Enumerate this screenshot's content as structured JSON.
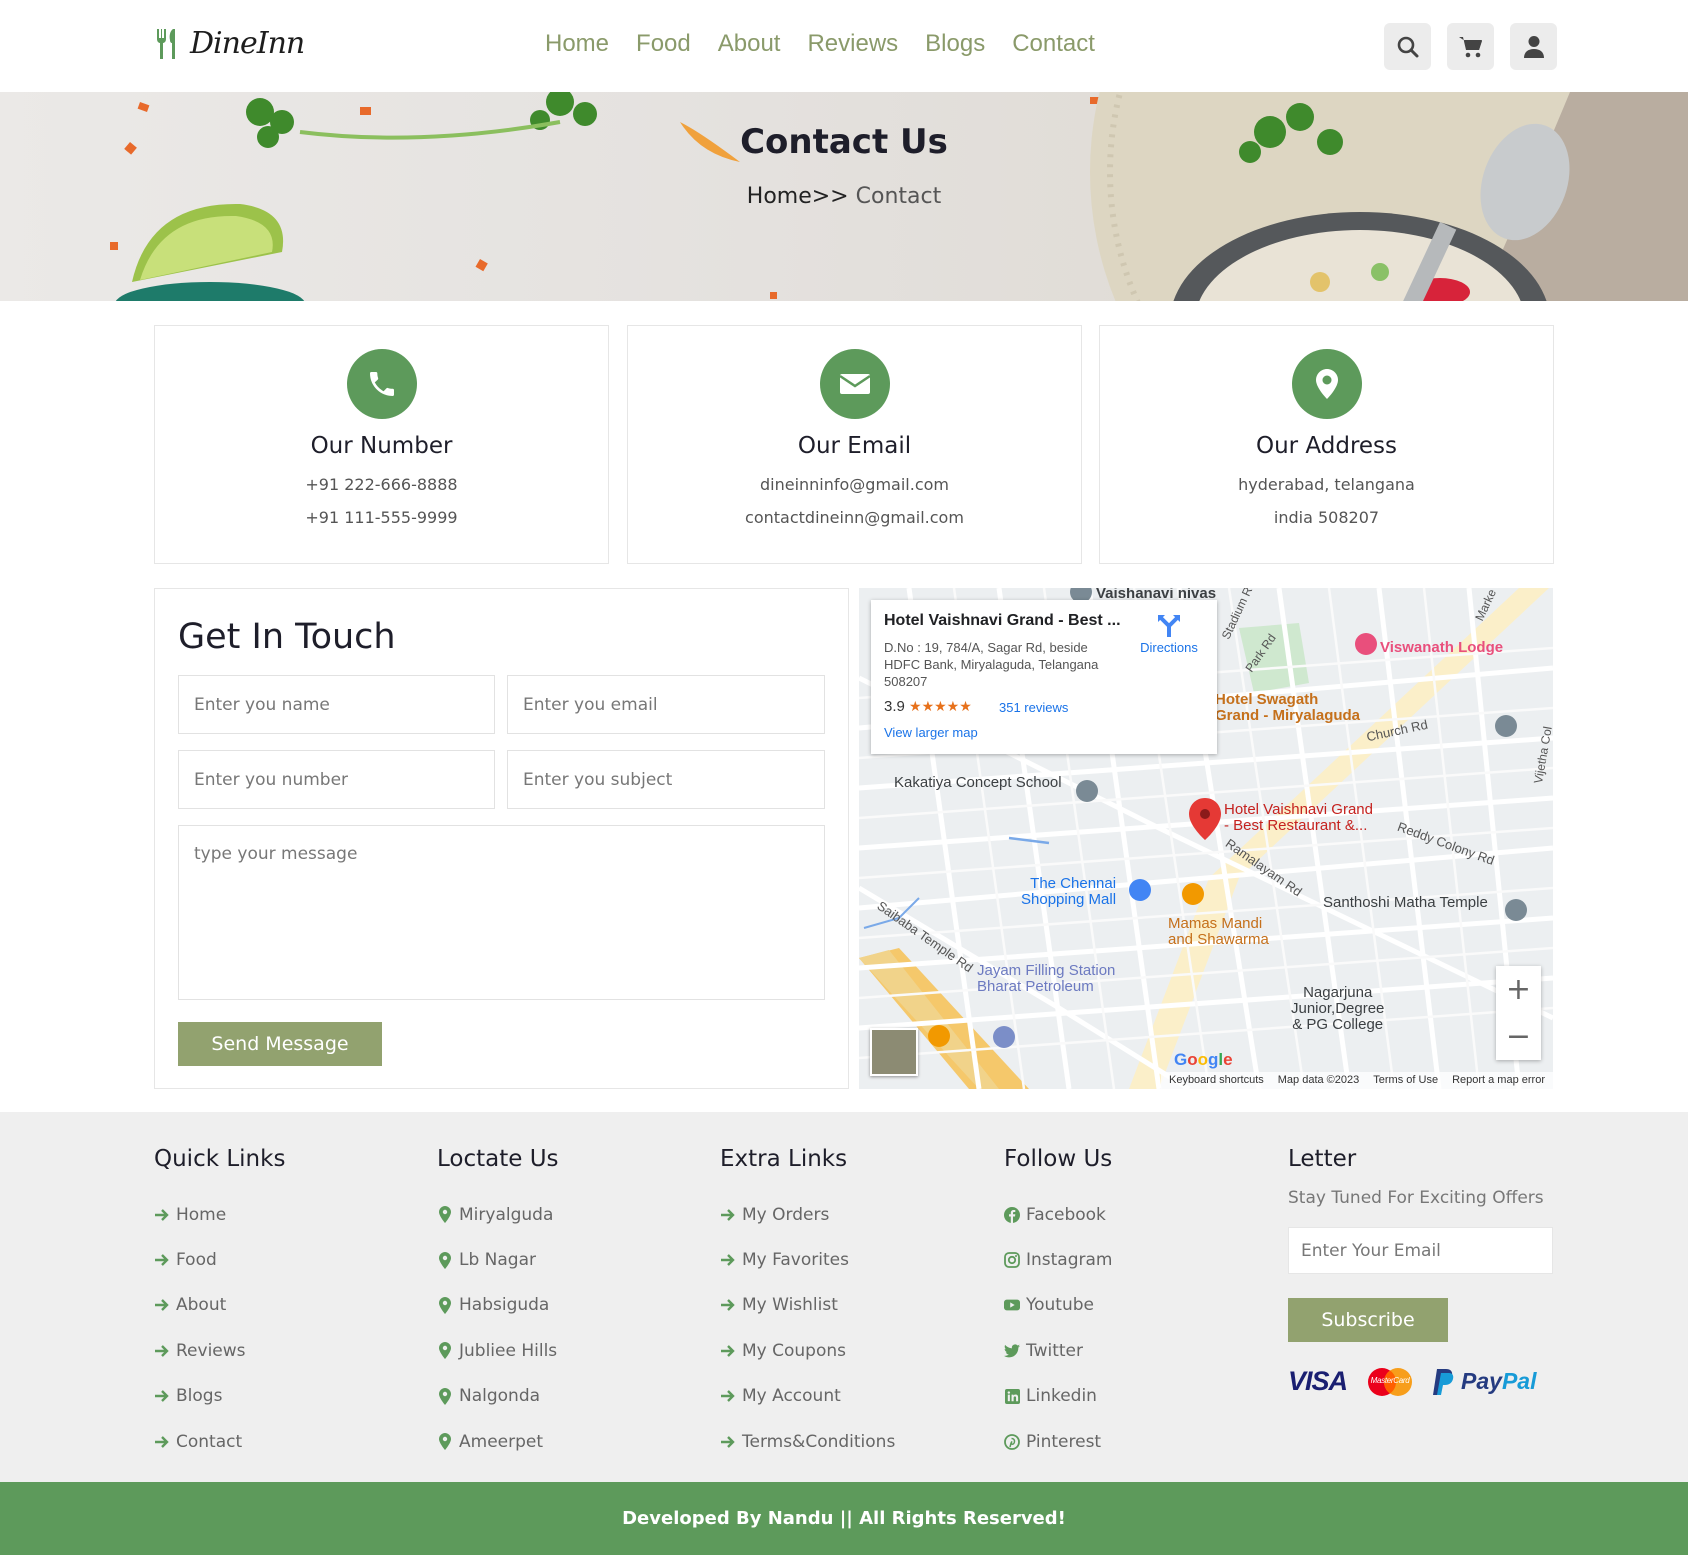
{
  "brand": {
    "name": "DineInn",
    "accent": "#5d9a5b",
    "olive": "#92a26f",
    "nav_color": "#8a9a6a"
  },
  "nav": [
    "Home",
    "Food",
    "About",
    "Reviews",
    "Blogs",
    "Contact"
  ],
  "header_icons": [
    "search-icon",
    "cart-icon",
    "user-icon"
  ],
  "hero": {
    "title": "Contact Us",
    "crumb_home": "Home>>",
    "crumb_current": " Contact"
  },
  "cards": [
    {
      "icon": "phone-icon",
      "title": "Our Number",
      "lines": [
        "+91 222-666-8888",
        "+91 111-555-9999"
      ]
    },
    {
      "icon": "envelope-icon",
      "title": "Our Email",
      "lines": [
        "dineinninfo@gmail.com",
        "contactdineinn@gmail.com"
      ]
    },
    {
      "icon": "map-pin-icon",
      "title": "Our Address",
      "lines": [
        "hyderabad, telangana",
        "india 508207"
      ]
    }
  ],
  "form": {
    "title": "Get In Touch",
    "name_placeholder": "Enter you name",
    "email_placeholder": "Enter you email",
    "number_placeholder": "Enter you number",
    "subject_placeholder": "Enter you subject",
    "message_placeholder": "type your message",
    "send_label": "Send Message"
  },
  "map": {
    "card_title": "Hotel Vaishnavi Grand - Best ...",
    "card_address": "D.No : 19, 784/A, Sagar Rd, beside HDFC Bank, Miryalaguda, Telangana 508207",
    "rating": "3.9",
    "stars": "★★★★★",
    "reviews": "351 reviews",
    "larger_map": "View larger map",
    "directions": "Directions",
    "labels": {
      "vaishanavi": "Vaishanavi nivas",
      "viswanath": "Viswanath Lodge",
      "swagath": "Hotel Swagath\nGrand - Miryalaguda",
      "church": "Church Rd",
      "kakatiya": "Kakatiya Concept School",
      "vaishnavi_pin": "Hotel Vaishnavi Grand\n- Best Restaurant &...",
      "reddy": "Reddy Colony Rd",
      "ramalayam": "Ramalayam Rd",
      "chennai": "The Chennai\nShopping Mall",
      "santhoshi": "Santhoshi Matha Temple",
      "saibaba": "Saibaba Temple Rd",
      "mamas": "Mamas Mandi\nand Shawarma",
      "jayam": "Jayam Filling Station\nBharat Petroleum",
      "nagarjuna": "Nagarjuna\nJunior,Degree\n& PG College",
      "park": "Park Rd",
      "stadium": "Stadium R",
      "vijetha": "Vijetha Col",
      "markets": "Marke"
    },
    "google": "Google",
    "footer": [
      "Keyboard shortcuts",
      "Map data ©2023",
      "Terms of Use",
      "Report a map error"
    ]
  },
  "footer": {
    "quick_links": {
      "title": "Quick Links",
      "items": [
        "Home",
        "Food",
        "About",
        "Reviews",
        "Blogs",
        "Contact"
      ]
    },
    "locate": {
      "title": "Loctate Us",
      "items": [
        "Miryalguda",
        "Lb Nagar",
        "Habsiguda",
        "Jubliee Hills",
        "Nalgonda",
        "Ameerpet"
      ]
    },
    "extra": {
      "title": "Extra Links",
      "items": [
        "My Orders",
        "My Favorites",
        "My Wishlist",
        "My Coupons",
        "My Account",
        "Terms&Conditions"
      ]
    },
    "follow": {
      "title": "Follow Us",
      "items": [
        "Facebook",
        "Instagram",
        "Youtube",
        "Twitter",
        "Linkedin",
        "Pinterest"
      ]
    },
    "letter": {
      "title": "Letter",
      "subtitle": "Stay Tuned For Exciting Offers",
      "placeholder": "Enter Your Email",
      "button": "Subscribe"
    },
    "payments": {
      "visa": "VISA",
      "mastercard": "MasterCard",
      "paypal_pay": "Pay",
      "paypal_pal": "Pal"
    }
  },
  "copyright": "Developed By Nandu || All Rights Reserved!"
}
